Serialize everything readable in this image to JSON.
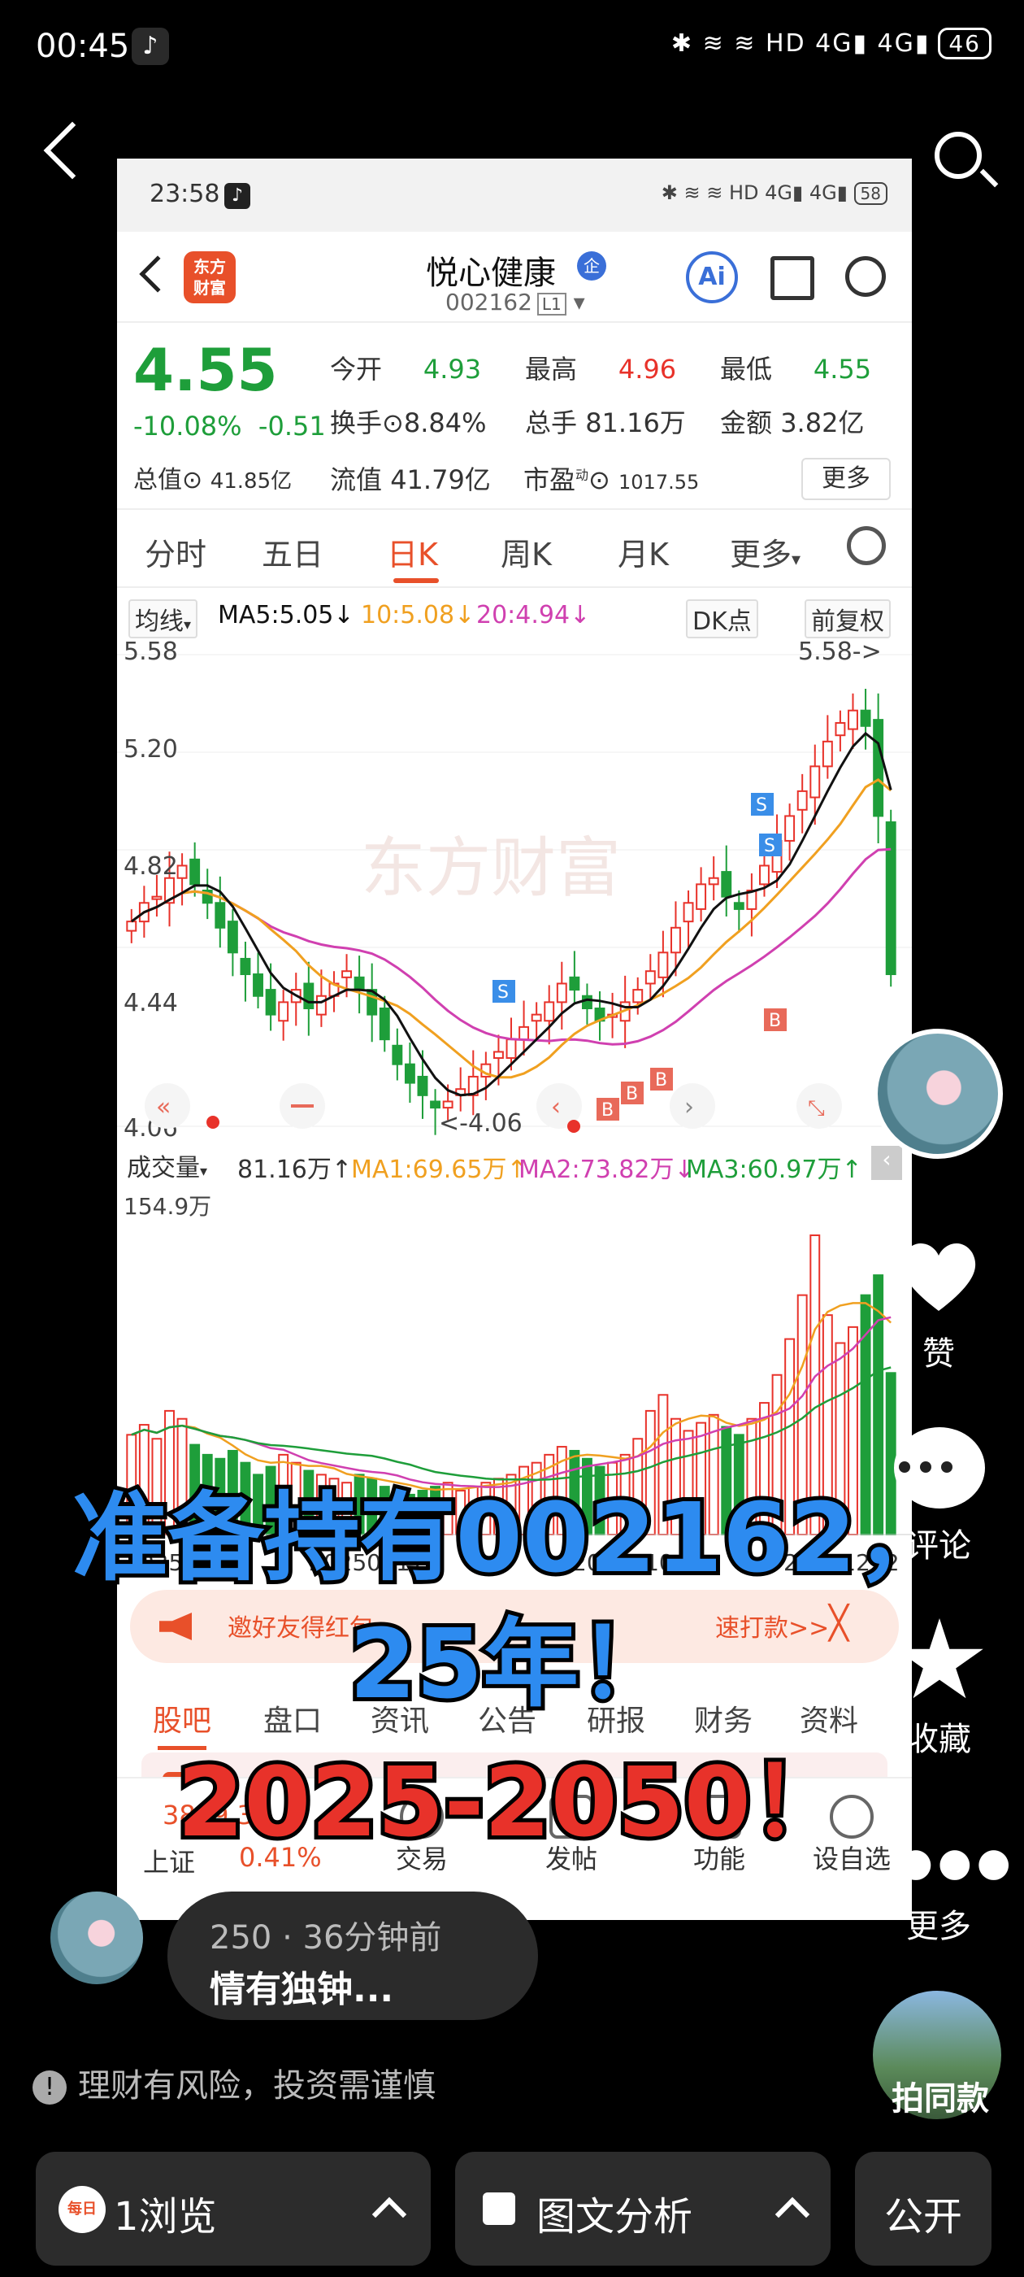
{
  "status": {
    "time": "00:45",
    "battery": "46",
    "icons": "✱ ≋ ≋ HD 4G▮ 4G▮"
  },
  "inner_status": {
    "time": "23:58",
    "battery": "58",
    "icons": "✱ ≋ ≋ HD 4G▮ 4G▮"
  },
  "stock": {
    "logo": "东方\n财富",
    "name": "悦心健康",
    "badge": "企",
    "code": "002162",
    "level": "L1",
    "price": "4.55",
    "change_pct": "-10.08%",
    "change": "-0.51",
    "open_label": "今开",
    "open": "4.93",
    "high_label": "最高",
    "high": "4.96",
    "low_label": "最低",
    "low": "4.55",
    "turnover_label": "换手",
    "turnover": "8.84%",
    "volume_label": "总手",
    "volume": "81.16万",
    "amount_label": "金额",
    "amount": "3.82亿",
    "mcap_label": "总值",
    "mcap": "41.85亿",
    "float_label": "流值",
    "float": "41.79亿",
    "pe_label": "市盈",
    "pe_sup": "动",
    "pe": "1017.55",
    "more": "更多"
  },
  "tabs": [
    "分时",
    "五日",
    "日K",
    "周K",
    "月K",
    "更多"
  ],
  "active_tab": "日K",
  "ma": {
    "selector": "均线",
    "ma5": "MA5:5.05↓",
    "ma10": "10:5.08↓",
    "ma20": "20:4.94↓",
    "dk": "DK点",
    "adjust": "前复权",
    "colors": {
      "ma5": "#111111",
      "ma10": "#f0a020",
      "ma20": "#d040b0"
    }
  },
  "chart_labels": {
    "y_top": "5.58",
    "y_2": "5.20",
    "y_3": "4.82",
    "y_4": "4.44",
    "y_bottom": "4.06",
    "max_note": "5.58->",
    "min_note": "<-4.06",
    "watermark": "东方财富"
  },
  "vol": {
    "selector": "成交量",
    "value": "81.16万↑",
    "ma1": "MA1:69.65万↑",
    "ma2": "MA2:73.82万↓",
    "ma3": "MA3:60.97万↑",
    "y_top": "154.9万"
  },
  "dates": [
    "20250813",
    "20250917",
    "20251104",
    "20251212"
  ],
  "promo": {
    "text": "邀好友得红包，",
    "text2": "速打款>>",
    "close": "╳"
  },
  "news_tabs": [
    "股吧",
    "盘口",
    "资讯",
    "公告",
    "研报",
    "财务",
    "资料"
  ],
  "popular": "人气榜",
  "bottom_nav": {
    "index_value": "3889.35",
    "index_name": "上证",
    "index_pct": "0.41%",
    "items": [
      "交易",
      "发帖",
      "功能",
      "设自选"
    ]
  },
  "caption": {
    "line1": "准备持有002162，",
    "line2": "25年！",
    "line3": "2025-2050！"
  },
  "sidebar": {
    "like": "赞",
    "comment": "评论",
    "favorite": "收藏",
    "more": "更多",
    "duet": "拍同款"
  },
  "comment": {
    "meta": "250 · 36分钟前",
    "text": "情有独钟..."
  },
  "risk_notice": "理财有风险，投资需谨慎",
  "bottom_bar": {
    "views": "1浏览",
    "analysis": "图文分析",
    "public": "公开",
    "views_badge": "每日"
  },
  "chart_data": {
    "type": "candlestick",
    "ylim": [
      4.06,
      5.58
    ],
    "x_labels": [
      "20250813",
      "20250917",
      "20251104",
      "20251212"
    ],
    "max": 5.58,
    "min": 4.06,
    "close_series": [
      4.72,
      4.78,
      4.8,
      4.86,
      4.9,
      4.84,
      4.78,
      4.7,
      4.62,
      4.55,
      4.48,
      4.42,
      4.46,
      4.5,
      4.44,
      4.48,
      4.52,
      4.56,
      4.5,
      4.42,
      4.34,
      4.26,
      4.2,
      4.16,
      4.12,
      4.14,
      4.18,
      4.22,
      4.26,
      4.3,
      4.34,
      4.38,
      4.42,
      4.46,
      4.52,
      4.5,
      4.44,
      4.4,
      4.42,
      4.46,
      4.5,
      4.56,
      4.62,
      4.7,
      4.78,
      4.84,
      4.86,
      4.8,
      4.76,
      4.82,
      4.9,
      4.98,
      5.06,
      5.14,
      5.22,
      5.3,
      5.36,
      5.4,
      5.35,
      5.06,
      4.55
    ],
    "volume_series": [
      50,
      55,
      48,
      62,
      58,
      45,
      40,
      38,
      42,
      36,
      30,
      34,
      40,
      36,
      32,
      30,
      28,
      26,
      30,
      28,
      24,
      22,
      20,
      22,
      24,
      26,
      22,
      24,
      26,
      28,
      30,
      34,
      36,
      40,
      44,
      42,
      38,
      34,
      36,
      40,
      48,
      62,
      70,
      58,
      52,
      56,
      60,
      54,
      50,
      58,
      66,
      80,
      98,
      120,
      150,
      110,
      96,
      104,
      120,
      130,
      81
    ]
  }
}
